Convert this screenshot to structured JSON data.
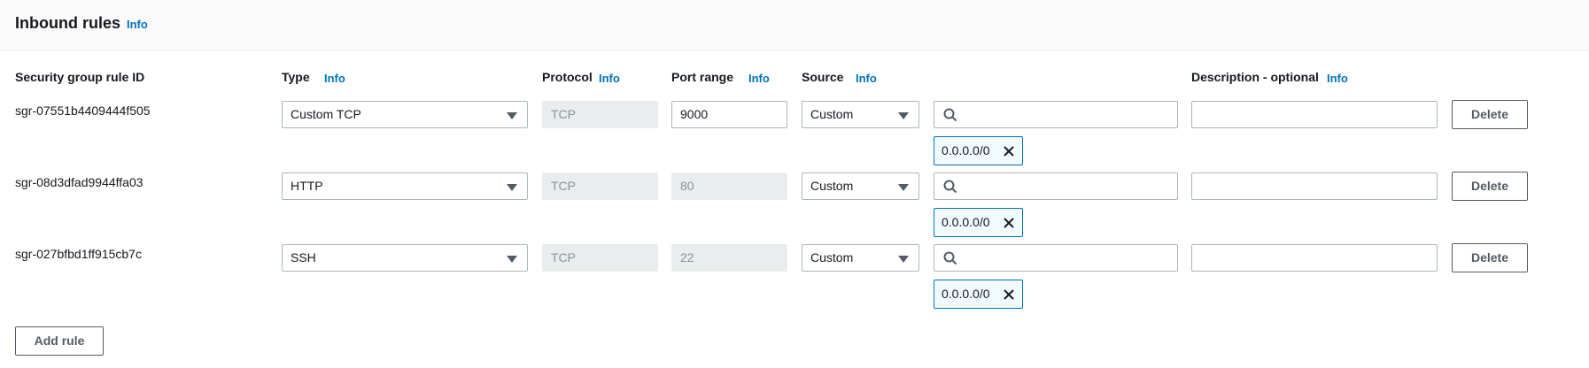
{
  "header": {
    "title": "Inbound rules",
    "info": "Info"
  },
  "columns": {
    "rule_id": "Security group rule ID",
    "type": "Type",
    "protocol": "Protocol",
    "port_range": "Port range",
    "source": "Source",
    "description": "Description - optional",
    "info": "Info"
  },
  "rules": [
    {
      "id": "sgr-07551b4409444f505",
      "type": "Custom TCP",
      "protocol": "TCP",
      "port": "9000",
      "port_editable": true,
      "source": "Custom",
      "search_value": "",
      "cidr": "0.0.0.0/0",
      "description": "",
      "delete": "Delete"
    },
    {
      "id": "sgr-08d3dfad9944ffa03",
      "type": "HTTP",
      "protocol": "TCP",
      "port": "80",
      "port_editable": false,
      "source": "Custom",
      "search_value": "",
      "cidr": "0.0.0.0/0",
      "description": "",
      "delete": "Delete"
    },
    {
      "id": "sgr-027bfbd1ff915cb7c",
      "type": "SSH",
      "protocol": "TCP",
      "port": "22",
      "port_editable": false,
      "source": "Custom",
      "search_value": "",
      "cidr": "0.0.0.0/0",
      "description": "",
      "delete": "Delete"
    }
  ],
  "add_rule": "Add rule",
  "icons": {
    "search": "search-icon",
    "remove": "close-icon",
    "dropdown": "caret-down-icon"
  },
  "colors": {
    "link": "#0073bb",
    "token_border": "#0073bb",
    "disabled_bg": "#eaeded"
  }
}
